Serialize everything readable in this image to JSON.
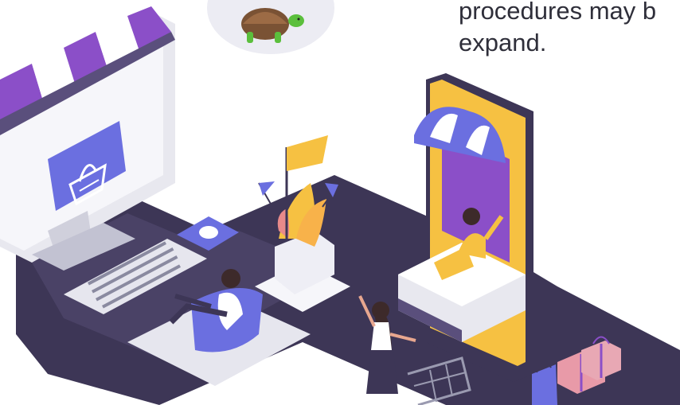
{
  "caption": {
    "line1": "procedures may b",
    "line2": "expand."
  },
  "colors": {
    "dark_base": "#3d3656",
    "purple": "#8b4fc8",
    "blue_violet": "#6b6fe0",
    "yellow": "#f6c142",
    "text": "#2f2f3a"
  },
  "icons": [
    "turtle-icon",
    "shopping-basket-icon",
    "shopping-cart-icon",
    "gift-box-icon",
    "shopping-bag-icon"
  ]
}
